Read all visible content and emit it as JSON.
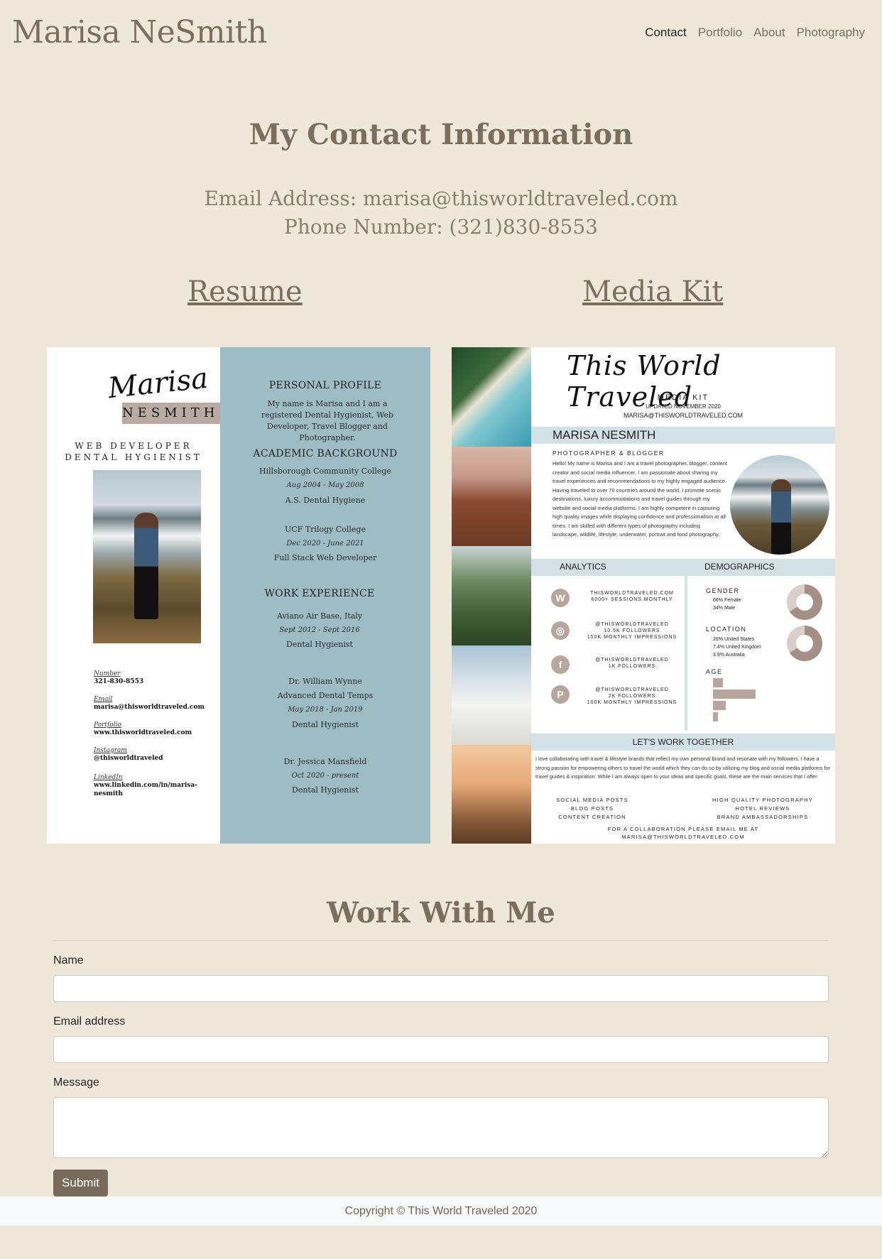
{
  "header": {
    "site_title": "Marisa NeSmith",
    "nav": [
      "Contact",
      "Portfolio",
      "About",
      "Photography"
    ],
    "active_nav": "Contact"
  },
  "contact": {
    "heading": "My Contact Information",
    "email_line": "Email Address: marisa@thisworldtraveled.com",
    "phone_line": "Phone Number: (321)830-8553"
  },
  "links": {
    "resume": "Resume",
    "media_kit": "Media Kit"
  },
  "resume": {
    "first_name": "Marisa",
    "last_name": "NESMITH",
    "role_1": "WEB DEVELOPER",
    "role_2": "DENTAL HYGIENIST",
    "profile_heading": "PERSONAL PROFILE",
    "profile_text": "My name is Marisa and I am a registered Dental Hygienist, Web Developer, Travel Blogger and Photographer.",
    "academic_heading": "ACADEMIC BACKGROUND",
    "academic": [
      {
        "school": "Hillsborough Community College",
        "dates": "Aug 2004 - May 2008",
        "degree": "A.S. Dental Hygiene"
      },
      {
        "school": "UCF Trilogy College",
        "dates": "Dec 2020 - June 2021",
        "degree": "Full Stack Web Developer"
      }
    ],
    "work_heading": "WORK EXPERIENCE",
    "work": [
      {
        "employer": "Aviano Air Base, Italy",
        "dates": "Sept 2012 - Sept 2016",
        "title": "Dental Hygienist"
      },
      {
        "employer": "Dr. William Wynne",
        "sub": "Advanced Dental Temps",
        "dates": "May 2018 - Jan 2019",
        "title": "Dental Hygienist"
      },
      {
        "employer": "Dr. Jessica Mansfield",
        "dates": "Oct 2020 - present",
        "title": "Dental Hygienist"
      }
    ],
    "contacts": [
      {
        "label": "Number",
        "value": "321-830-8553"
      },
      {
        "label": "Email",
        "value": "marisa@thisworldtraveled.com"
      },
      {
        "label": "Portfolio",
        "value": "www.thisworldtraveled.com"
      },
      {
        "label": "Instagram",
        "value": "@thisworldtraveled"
      },
      {
        "label": "LinkedIn",
        "value": "www.linkedin.com/in/marisa-nesmith"
      }
    ]
  },
  "mediakit": {
    "script_title": "This World Traveled",
    "kit_label": "MEDIA KIT",
    "updated": "UPDATED NOVEMBER 2020",
    "email": "MARISA@THISWORLDTRAVELED.COM",
    "name": "MARISA NESMITH",
    "subtitle": "PHOTOGRAPHER & BLOGGER",
    "bio": "Hello! My name is Marisa and I am a travel photographer, blogger, content creator and social media influencer. I am passionate about sharing my travel experiences and recommendations to my highly engaged audience. Having traveled to over 70 countries around the world, I promote scenic destinations, luxury accommodations and travel guides through my website and social media platforms. I am highly competent in capturing high quality images while displaying confidence and professionalism at all times. I am skilled with different types of photography including landscape, wildlife, lifestyle, underwater, portrait and food photography.",
    "analytics_heading": "ANALYTICS",
    "demographics_heading": "DEMOGRAPHICS",
    "analytics": [
      {
        "icon": "W",
        "icon_name": "wordpress-icon",
        "lines": "THISWORLDTRAVELED.COM\n6000+ SESSIONS MONTHLY"
      },
      {
        "icon": "◎",
        "icon_name": "instagram-icon",
        "lines": "@THISWORLDTRAVELED\n10.5K FOLLOWERS\n150K MONTHLY IMPRESSIONS"
      },
      {
        "icon": "f",
        "icon_name": "facebook-icon",
        "lines": "@THISWORLDTRAVELED\n1K FOLLOWERS"
      },
      {
        "icon": "P",
        "icon_name": "pinterest-icon",
        "lines": "@THISWORLDTRAVELED\n2K FOLLOWERS\n100K MONTHLY IMPRESSIONS"
      }
    ],
    "gender_heading": "GENDER",
    "gender": [
      "66% Female",
      "34% Male"
    ],
    "location_heading": "LOCATION",
    "location": [
      "26% United States",
      "7.4% United Kingdom",
      "3.9% Australia"
    ],
    "age_heading": "AGE",
    "age_bars": [
      0.2,
      0.85,
      0.25,
      0.1
    ],
    "together_heading": "LET'S WORK TOGETHER",
    "together_text": "I love collaborating with travel & lifestyle brands that reflect my own personal brand and resonate with my followers. I have a strong passion for empowering others to travel the world which they can do so by utilizing my blog and social media platforms for travel guides & inspiration. While I am always open to your ideas and specific goals, these are the main services that I offer.",
    "services_left": [
      "SOCIAL MEDIA POSTS",
      "BLOG POSTS",
      "CONTENT CREATION"
    ],
    "services_right": [
      "HIGH QUALITY PHOTOGRAPHY",
      "HOTEL REVIEWS",
      "BRAND AMBASSADORSHIPS"
    ],
    "collab_1": "FOR A COLLABORATION PLEASE EMAIL ME AT",
    "collab_2": "MARISA@THISWORLDTRAVELED.COM"
  },
  "form": {
    "heading": "Work With Me",
    "name_label": "Name",
    "name_value": "",
    "email_label": "Email address",
    "email_value": "",
    "message_label": "Message",
    "message_value": "",
    "submit_label": "Submit"
  },
  "footer": {
    "copyright": "Copyright © This World Traveled 2020"
  },
  "colors": {
    "background": "#eee8db",
    "accent": "#776c5b",
    "resume_panel": "#9dbcc4",
    "mediakit_bar": "#d3e0e4"
  }
}
